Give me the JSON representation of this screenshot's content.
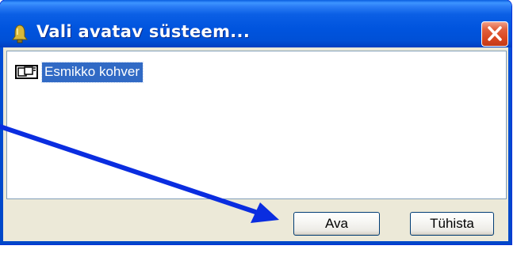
{
  "window": {
    "title": "Vali avatav süsteem...",
    "title_icon": "bell-icon",
    "close_icon": "close-icon"
  },
  "list": {
    "items": [
      {
        "label": "Esmikko kohver",
        "icon": "system-icon",
        "selected": true
      }
    ]
  },
  "buttons": {
    "open_label": "Ava",
    "cancel_label": "Tühista"
  },
  "colors": {
    "titlebar": "#0054de",
    "close_button": "#d8461f",
    "selection": "#316ac5",
    "dialog_face": "#ece9d8",
    "annotation_arrow": "#0a2de0"
  }
}
